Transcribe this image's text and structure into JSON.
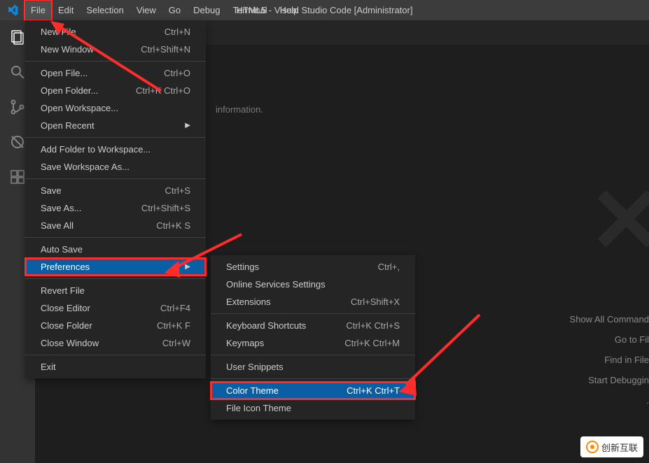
{
  "title": "HTML5 - Visual Studio Code [Administrator]",
  "menu_bar": [
    "File",
    "Edit",
    "Selection",
    "View",
    "Go",
    "Debug",
    "Terminal",
    "Help"
  ],
  "file_menu": {
    "groups": [
      [
        {
          "label": "New File",
          "shortcut": "Ctrl+N"
        },
        {
          "label": "New Window",
          "shortcut": "Ctrl+Shift+N"
        }
      ],
      [
        {
          "label": "Open File...",
          "shortcut": "Ctrl+O"
        },
        {
          "label": "Open Folder...",
          "shortcut": "Ctrl+K Ctrl+O"
        },
        {
          "label": "Open Workspace...",
          "shortcut": ""
        },
        {
          "label": "Open Recent",
          "shortcut": "",
          "submenu": true
        }
      ],
      [
        {
          "label": "Add Folder to Workspace...",
          "shortcut": ""
        },
        {
          "label": "Save Workspace As...",
          "shortcut": ""
        }
      ],
      [
        {
          "label": "Save",
          "shortcut": "Ctrl+S"
        },
        {
          "label": "Save As...",
          "shortcut": "Ctrl+Shift+S"
        },
        {
          "label": "Save All",
          "shortcut": "Ctrl+K S"
        }
      ],
      [
        {
          "label": "Auto Save",
          "shortcut": ""
        },
        {
          "label": "Preferences",
          "shortcut": "",
          "submenu": true,
          "hot": true
        }
      ],
      [
        {
          "label": "Revert File",
          "shortcut": ""
        },
        {
          "label": "Close Editor",
          "shortcut": "Ctrl+F4"
        },
        {
          "label": "Close Folder",
          "shortcut": "Ctrl+K F"
        },
        {
          "label": "Close Window",
          "shortcut": "Ctrl+W"
        }
      ],
      [
        {
          "label": "Exit",
          "shortcut": ""
        }
      ]
    ]
  },
  "pref_menu": {
    "groups": [
      [
        {
          "label": "Settings",
          "shortcut": "Ctrl+,"
        },
        {
          "label": "Online Services Settings",
          "shortcut": ""
        },
        {
          "label": "Extensions",
          "shortcut": "Ctrl+Shift+X"
        }
      ],
      [
        {
          "label": "Keyboard Shortcuts",
          "shortcut": "Ctrl+K Ctrl+S"
        },
        {
          "label": "Keymaps",
          "shortcut": "Ctrl+K Ctrl+M"
        }
      ],
      [
        {
          "label": "User Snippets",
          "shortcut": ""
        }
      ],
      [
        {
          "label": "Color Theme",
          "shortcut": "Ctrl+K Ctrl+T",
          "hot": true
        },
        {
          "label": "File Icon Theme",
          "shortcut": ""
        }
      ]
    ]
  },
  "info_line": "information.",
  "hints": [
    "Show All Command",
    "Go to Fil",
    "Find in File",
    "Start Debuggin",
    "."
  ],
  "brand": "创新互联"
}
